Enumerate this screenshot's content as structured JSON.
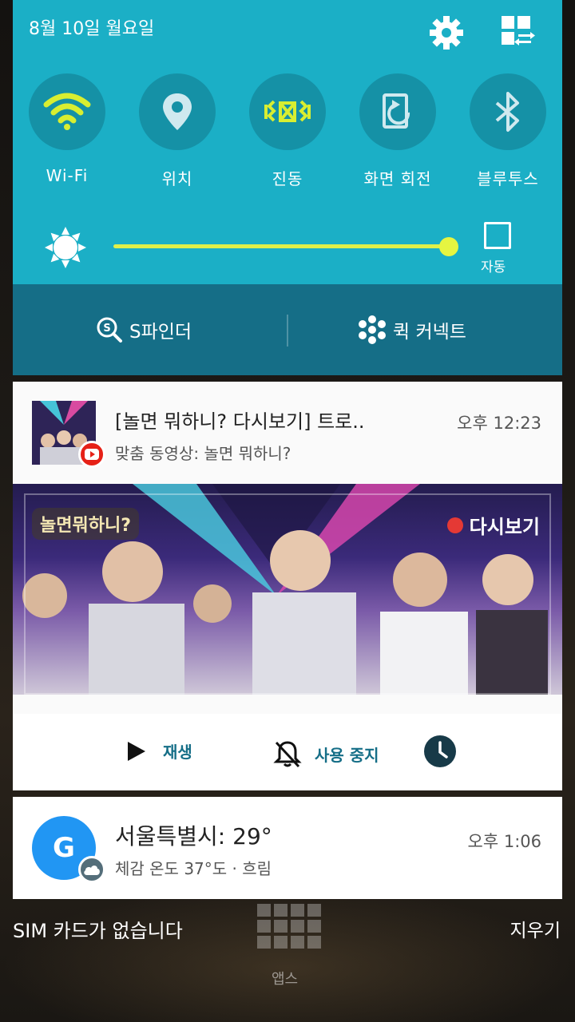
{
  "status": {
    "date": "8월 10일 월요일"
  },
  "quick_settings": {
    "toggles": [
      {
        "label": "Wi-Fi",
        "icon": "wifi-icon",
        "active": true
      },
      {
        "label": "위치",
        "icon": "location-icon",
        "active": false
      },
      {
        "label": "진동",
        "icon": "vibrate-icon",
        "active": true
      },
      {
        "label": "화면 회전",
        "icon": "rotate-icon",
        "active": false
      },
      {
        "label": "블루투스",
        "icon": "bluetooth-icon",
        "active": false
      }
    ],
    "brightness": {
      "level": 1.0,
      "auto_label": "자동",
      "auto": false
    },
    "s_finder_label": "S파인더",
    "quick_connect_label": "퀵 커넥트"
  },
  "notifications": [
    {
      "app": "youtube",
      "title": "[놀면 뭐하니? 다시보기] 트로..",
      "subtitle": "맞춤 동영상: 놀면 뭐하니?",
      "time": "오후 12:23",
      "image_logo_text": "놀면뭐하니?",
      "image_badge_text": "다시보기",
      "actions": {
        "play": "재생",
        "stop": "사용 중지"
      }
    },
    {
      "app": "google",
      "avatar_letter": "G",
      "title": "서울특별시: 29°",
      "subtitle": "체감 온도 37°도 · 흐림",
      "time": "오후 1:06"
    }
  ],
  "footer": {
    "sim_text": "SIM 카드가 없습니다",
    "clear_label": "지우기",
    "apps_label": "앱스"
  },
  "colors": {
    "panel": "#1bafc6",
    "panel_dark": "#156e87",
    "accent": "#dff04a"
  }
}
